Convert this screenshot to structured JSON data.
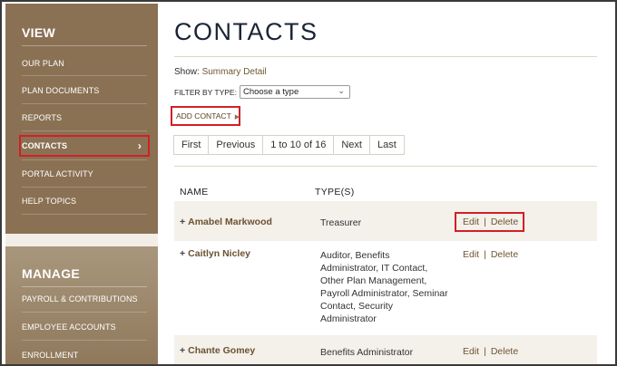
{
  "sidebar": {
    "view_heading": "VIEW",
    "view_items": [
      {
        "label": "OUR PLAN"
      },
      {
        "label": "PLAN DOCUMENTS"
      },
      {
        "label": "REPORTS"
      },
      {
        "label": "CONTACTS"
      },
      {
        "label": "PORTAL ACTIVITY"
      },
      {
        "label": "HELP TOPICS"
      }
    ],
    "active_item": "CONTACTS",
    "manage_heading": "MANAGE",
    "manage_items": [
      {
        "label": "PAYROLL & CONTRIBUTIONS"
      },
      {
        "label": "EMPLOYEE ACCOUNTS"
      },
      {
        "label": "ENROLLMENT"
      }
    ]
  },
  "main": {
    "title": "CONTACTS",
    "show_label": "Show:",
    "show_summary": "Summary",
    "show_detail": "Detail",
    "filter_label": "FILTER BY TYPE:",
    "filter_value": "Choose a type",
    "add_contact": "ADD CONTACT",
    "pager": {
      "first": "First",
      "previous": "Previous",
      "range": "1 to 10 of 16",
      "next": "Next",
      "last": "Last"
    },
    "columns": [
      "NAME",
      "TYPE(S)"
    ],
    "contacts": [
      {
        "name": "Amabel Markwood",
        "types": "Treasurer",
        "edit": "Edit",
        "delete": "Delete"
      },
      {
        "name": "Caitlyn Nicley",
        "types": "Auditor, Benefits Administrator, IT Contact, Other Plan Management, Payroll Administrator, Seminar Contact, Security Administrator",
        "edit": "Edit",
        "delete": "Delete"
      },
      {
        "name": "Chante Gomey",
        "types": "Benefits Administrator",
        "edit": "Edit",
        "delete": "Delete"
      }
    ],
    "action_separator": "|"
  },
  "colors": {
    "sidebar_brown": "#8a7154",
    "title_navy": "#1a2535",
    "link_brown": "#6e5632",
    "highlight_red": "#d21f26"
  }
}
